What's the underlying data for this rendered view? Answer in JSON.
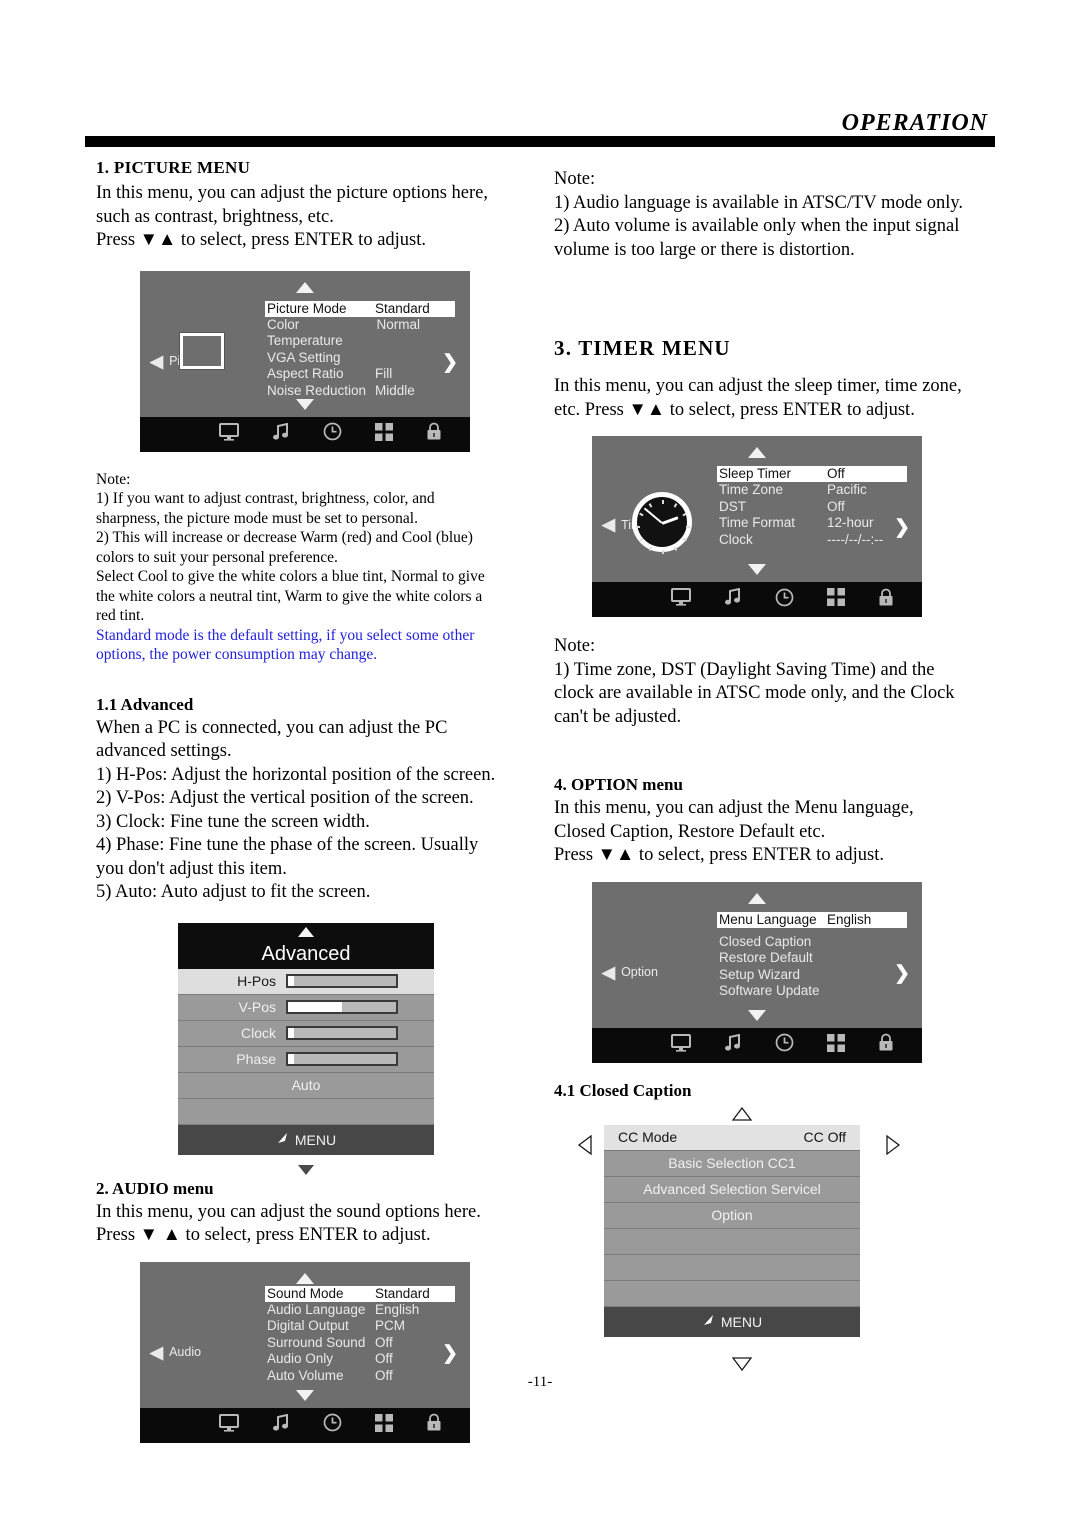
{
  "header": {
    "title": "OPERATION"
  },
  "page_number": "-11-",
  "colors": {
    "note_highlight": "#2222dd",
    "osd_bg": "#6e6e6e",
    "osd_bar": "#0a0a0a"
  },
  "left_column": {
    "picture_section": {
      "heading": "1. PICTURE MENU",
      "body_lines": [
        "In this menu, you can adjust the picture options here,",
        "such as contrast, brightness, etc.",
        "Press ▼▲ to select, press ENTER to adjust."
      ]
    },
    "picture_osd": {
      "left_label": "Picture",
      "chevron_left": "◀",
      "chevron_right": "❯",
      "center_icon": "screen-thumbnail-icon",
      "rows": [
        {
          "label": "Picture Mode",
          "value": "Standard",
          "selected": true
        },
        {
          "label": "Color Temperature",
          "value": "Normal",
          "selected": false
        },
        {
          "label": "VGA Setting",
          "value": "",
          "selected": false
        },
        {
          "label": "Aspect Ratio",
          "value": "Fill",
          "selected": false
        },
        {
          "label": "Noise Reduction",
          "value": "Middle",
          "selected": false
        }
      ],
      "iconbar": [
        "monitor-icon",
        "music-note-icon",
        "clock-icon",
        "grid-icon",
        "lock-icon"
      ]
    },
    "picture_note": {
      "title": "Note:",
      "lines": [
        "1) If you want to adjust contrast, brightness, color, and",
        "sharpness, the picture mode must be set to personal.",
        "2) This will increase or decrease Warm (red) and Cool (blue)",
        "colors to suit your personal preference.",
        "Select Cool to give the white colors a blue tint, Normal to give",
        "the white colors a neutral tint, Warm to give the white colors a",
        "red tint."
      ],
      "highlighted_lines": [
        "Standard mode is the default setting, if you select some other",
        "options, the power consumption may change."
      ]
    },
    "advanced_section": {
      "heading": "1.1 Advanced",
      "body_lines": [
        "When a PC is connected, you can adjust the PC",
        "advanced settings.",
        "1) H-Pos: Adjust the horizontal position of the screen.",
        "2) V-Pos: Adjust the vertical position of the screen.",
        "3) Clock: Fine tune the screen width.",
        "4) Phase: Fine tune the phase of the screen. Usually",
        "you don't adjust this item.",
        "5) Auto: Auto adjust to fit the screen."
      ]
    },
    "advanced_osd": {
      "title": "Advanced",
      "rows": [
        {
          "label": "H-Pos",
          "slider": 6,
          "selected": true,
          "type": "slider"
        },
        {
          "label": "V-Pos",
          "slider": 50,
          "selected": false,
          "type": "slider"
        },
        {
          "label": "Clock",
          "slider": 6,
          "selected": false,
          "type": "slider"
        },
        {
          "label": "Phase",
          "slider": 6,
          "selected": false,
          "type": "slider"
        },
        {
          "label": "Auto",
          "slider": 0,
          "selected": false,
          "type": "action"
        },
        {
          "label": "",
          "slider": 0,
          "selected": false,
          "type": "blank"
        }
      ],
      "menu_label": "MENU"
    },
    "audio_section": {
      "heading": "2. AUDIO menu",
      "body_lines": [
        "In this menu, you can adjust the sound options here.",
        "Press ▼ ▲ to select, press ENTER to adjust."
      ]
    },
    "audio_osd": {
      "left_label": "Audio",
      "rows": [
        {
          "label": "Sound Mode",
          "value": "Standard",
          "selected": true
        },
        {
          "label": "Audio Language",
          "value": "English",
          "selected": false
        },
        {
          "label": "Digital Output",
          "value": "PCM",
          "selected": false
        },
        {
          "label": "Surround Sound",
          "value": "Off",
          "selected": false
        },
        {
          "label": "Audio Only",
          "value": "Off",
          "selected": false
        },
        {
          "label": "Auto Volume",
          "value": "Off",
          "selected": false
        }
      ]
    }
  },
  "right_column": {
    "audio_note": {
      "title": "Note:",
      "lines": [
        "1) Audio language is available in ATSC/TV mode only.",
        "2) Auto volume is available only when the input signal",
        "volume is too large or there is distortion."
      ]
    },
    "timer_section": {
      "heading": "3. TIMER MENU",
      "body_lines": [
        "In this menu, you can adjust the sleep timer, time zone,",
        "etc. Press ▼▲ to select, press ENTER to adjust."
      ]
    },
    "timer_osd": {
      "left_label": "Time",
      "center_icon": "analog-clock-icon",
      "rows": [
        {
          "label": "Sleep Timer",
          "value": "Off",
          "selected": true
        },
        {
          "label": "Time Zone",
          "value": "Pacific",
          "selected": false
        },
        {
          "label": "DST",
          "value": "Off",
          "selected": false
        },
        {
          "label": "Time Format",
          "value": "12-hour",
          "selected": false
        },
        {
          "label": "Clock",
          "value": "----/--/--:--",
          "selected": false
        }
      ]
    },
    "timer_note": {
      "title": "Note:",
      "lines": [
        "1) Time zone, DST (Daylight Saving Time) and the",
        "clock are available in ATSC mode only, and the Clock",
        "can't be adjusted."
      ]
    },
    "option_section": {
      "heading": "4. OPTION menu",
      "body_lines": [
        "In this menu, you can adjust the Menu language,",
        "Closed Caption, Restore Default etc.",
        "Press ▼▲ to select, press ENTER to adjust."
      ]
    },
    "option_osd": {
      "left_label": "Option",
      "rows": [
        {
          "label": "Menu Language",
          "value": "English",
          "selected": true
        },
        {
          "label": "Closed Caption",
          "value": "",
          "selected": false
        },
        {
          "label": "Restore Default",
          "value": "",
          "selected": false
        },
        {
          "label": "Setup Wizard",
          "value": "",
          "selected": false
        },
        {
          "label": "Software Update",
          "value": "",
          "selected": false
        }
      ]
    },
    "cc_section": {
      "heading": "4.1 Closed Caption"
    },
    "cc_osd": {
      "rows": [
        {
          "label": "CC Mode",
          "value": "CC Off",
          "selected": true
        },
        {
          "label": "Basic Selection CC1",
          "value": "",
          "selected": false
        },
        {
          "label": "Advanced Selection Servicel",
          "value": "",
          "selected": false
        },
        {
          "label": "Option",
          "value": "",
          "selected": false
        },
        {
          "label": "",
          "value": "",
          "selected": false
        },
        {
          "label": "",
          "value": "",
          "selected": false
        },
        {
          "label": "",
          "value": "",
          "selected": false
        }
      ],
      "menu_label": "MENU"
    }
  }
}
